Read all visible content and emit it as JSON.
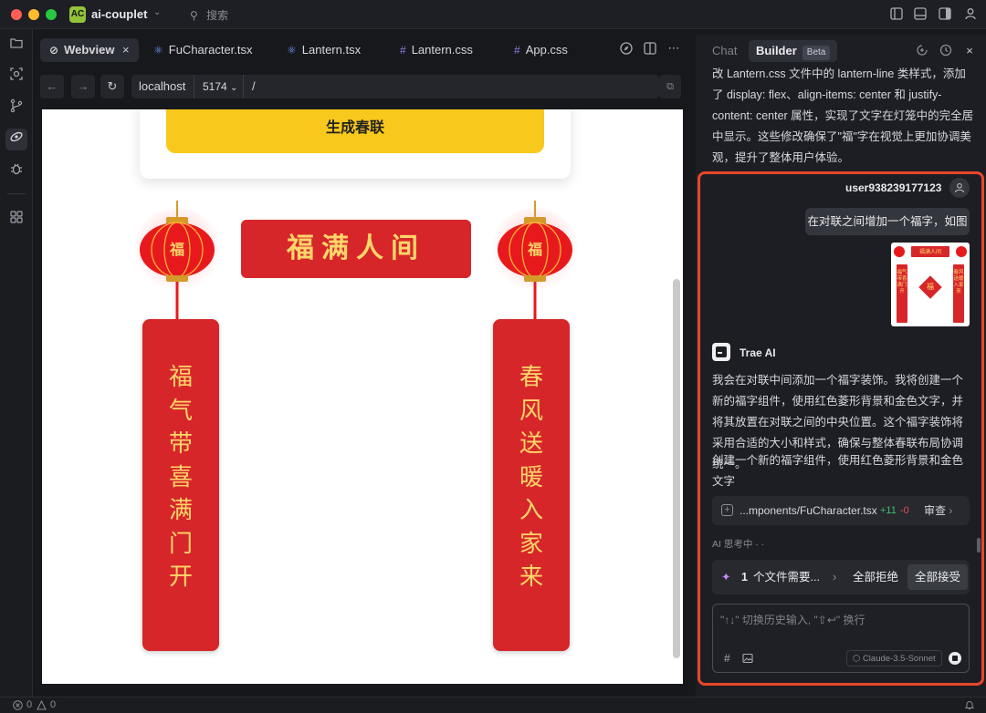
{
  "window": {
    "project_initials": "AC",
    "project_name": "ai-couplet",
    "search_label": "搜索",
    "colors": {
      "accent_logo": "#93c23a",
      "highlight": "#e8462c"
    }
  },
  "activity_bar": {
    "items": [
      "explorer-icon",
      "search-code-icon",
      "source-control-icon",
      "webview-icon",
      "debug-icon",
      "extensions-icon"
    ]
  },
  "tabs": [
    {
      "label": "Webview",
      "icon": "link-icon"
    },
    {
      "label": "FuCharacter.tsx",
      "icon": "react-icon"
    },
    {
      "label": "Lantern.tsx",
      "icon": "react-icon"
    },
    {
      "label": "Lantern.css",
      "icon": "hash-icon"
    },
    {
      "label": "App.css",
      "icon": "hash-icon"
    }
  ],
  "address_bar": {
    "host": "localhost",
    "port": "5174",
    "path": "/"
  },
  "webview": {
    "generate_button": "生成春联",
    "horizontal_scroll": "福满人间",
    "lantern_char": "福",
    "left_couplet": [
      "福",
      "气",
      "带",
      "喜",
      "满",
      "门",
      "开"
    ],
    "right_couplet": [
      "春",
      "风",
      "送",
      "暖",
      "入",
      "家",
      "来"
    ]
  },
  "panel": {
    "tab_chat": "Chat",
    "tab_builder": "Builder",
    "badge_beta": "Beta",
    "previous_text": "改 Lantern.css 文件中的 lantern-line 类样式，添加了 display: flex、align-items: center 和 justify-content: center 属性，实现了文字在灯笼中的完全居中显示。这些修改确保了\"福\"字在视觉上更加协调美观，提升了整体用户体验。",
    "user_name": "user938239177123",
    "user_message": "在对联之间增加一个福字，如图",
    "thumb": {
      "top": "福满人间",
      "left": "福气带喜满门开",
      "right": "春风送暖入家来",
      "center": "福"
    },
    "ai_name": "Trae AI",
    "ai_message_1": "我会在对联中间添加一个福字装饰。我将创建一个新的福字组件，使用红色菱形背景和金色文字，并将其放置在对联之间的中央位置。这个福字装饰将采用合适的大小和样式，确保与整体春联布局协调统一。",
    "ai_message_2": "创建一个新的福字组件，使用红色菱形背景和金色文字",
    "file_card": {
      "path": "...mponents/FuCharacter.tsx",
      "added": "+11",
      "removed": "-0",
      "review": "审查"
    },
    "thinking": "AI 思考中 · ·",
    "pending": {
      "count": "1",
      "text": "个文件需要...",
      "reject_all": "全部拒绝",
      "accept_all": "全部接受"
    },
    "input": {
      "placeholder": "\"↑↓\" 切换历史输入, \"⇧↩\" 换行",
      "model": "Claude-3.5-Sonnet"
    }
  },
  "statusbar": {
    "errors": "0",
    "warnings": "0"
  }
}
